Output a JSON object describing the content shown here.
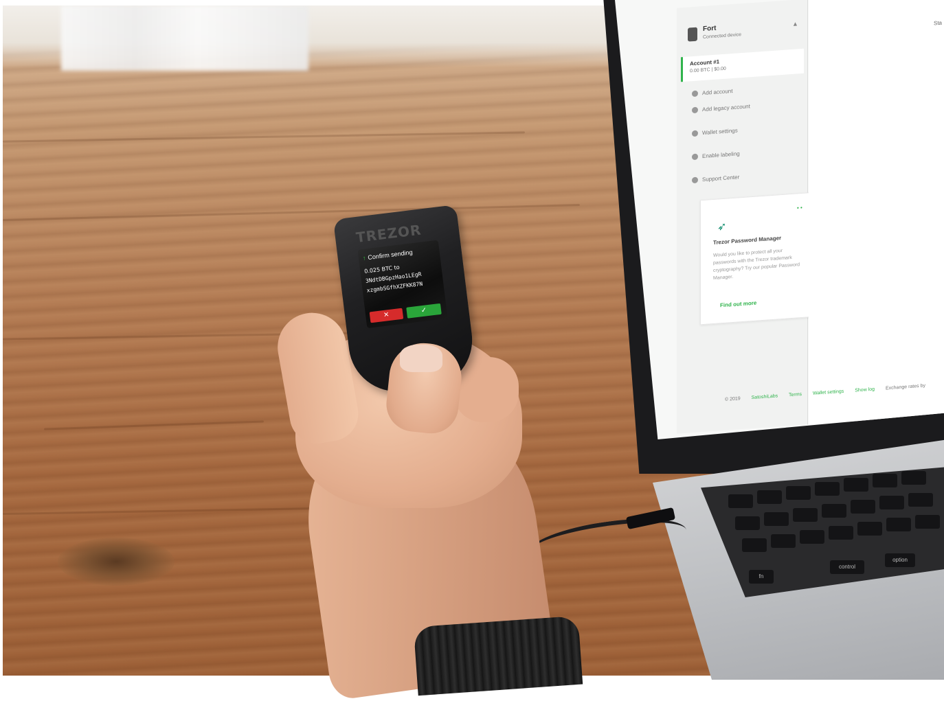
{
  "device": {
    "brand": "TREZOR",
    "screen_title": "Confirm sending",
    "amount_line": "0.025 BTC to",
    "address_line1": "3NdtDBGpzHao1LEgR",
    "address_line2": "xzgmbSGfhXZFKK87N",
    "cancel_label": "✕",
    "confirm_label": "✓"
  },
  "laptop": {
    "sidebar": {
      "device_name": "Fort",
      "device_status": "Connected device",
      "account_name": "Account #1",
      "account_balance": "0.00 BTC | $0.00",
      "items": [
        "Add account",
        "Add legacy account",
        "Wallet settings",
        "Enable labeling",
        "Support Center"
      ]
    },
    "promo": {
      "title": "Trezor Password Manager",
      "body": "Would you like to protect all your passwords with the Trezor trademark cryptography? Try our popular Password Manager.",
      "link": "Find out more"
    },
    "footer": {
      "copyright": "© 2019",
      "links": [
        "SatoshiLabs",
        "Terms",
        "Wallet settings",
        "Show log"
      ],
      "right_text": "Exchange rates by"
    },
    "main_label": "Sta"
  },
  "keyboard": {
    "keys": [
      "fn",
      "control",
      "option"
    ]
  }
}
